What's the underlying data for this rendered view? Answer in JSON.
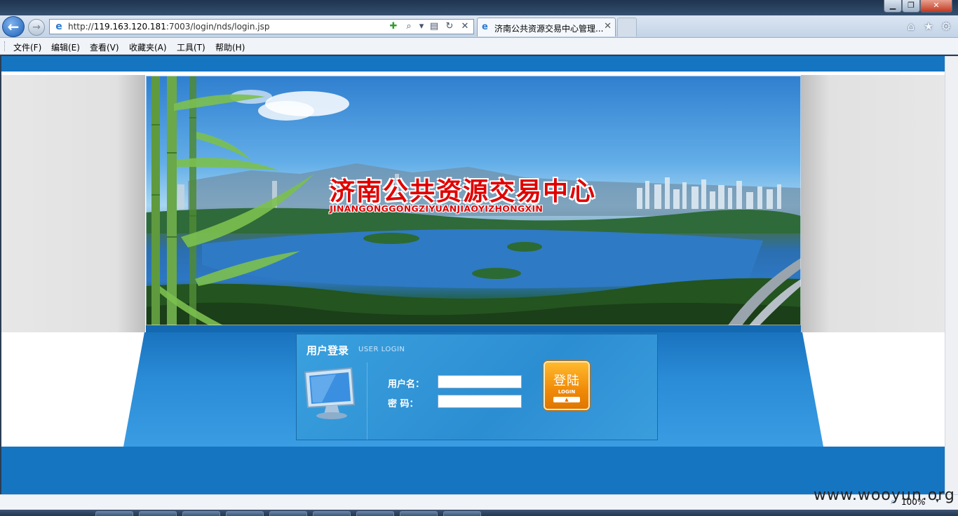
{
  "browser": {
    "address_url_prefix": "http://",
    "address_url_host": "119.163.120.181",
    "address_url_path": ":7003/login/nds/login.jsp",
    "back_glyph": "←",
    "forward_glyph": "→",
    "tab_title": "济南公共资源交易中心管理...",
    "tab_close_glyph": "✕",
    "window_min_glyph": "▁",
    "window_max_glyph": "❐",
    "window_close_glyph": "✕",
    "address_icons": [
      "compat-view-icon",
      "search-icon",
      "dropdown-icon",
      "compat-icon",
      "refresh-icon",
      "stop-icon"
    ],
    "address_icon_glyphs": [
      "✚",
      "⌕",
      "▾",
      "▤",
      "↻",
      "✕"
    ],
    "nav_right_glyphs": [
      "⌂",
      "★",
      "⚙"
    ]
  },
  "menu": {
    "items": [
      "文件(F)",
      "编辑(E)",
      "查看(V)",
      "收藏夹(A)",
      "工具(T)",
      "帮助(H)"
    ]
  },
  "banner": {
    "title": "济南公共资源交易中心",
    "subtitle": "JINANGONGGONGZIYUANJIAOYIZHONGXIN"
  },
  "login": {
    "title": "用户登录",
    "title_en": "USER  LOGIN",
    "username_label": "用户名：",
    "password_label": "密    码：",
    "username_value": "",
    "password_value": "",
    "button_label": "登陆",
    "button_sub": "LOGIN",
    "button_arrow": "▲"
  },
  "status": {
    "zoom": "100%",
    "zoom_arrow": "▾",
    "watermark": "www.wooyun.org"
  },
  "colors": {
    "page_blue": "#1675c1",
    "login_orange": "#f08a07",
    "title_red": "#e00000"
  }
}
